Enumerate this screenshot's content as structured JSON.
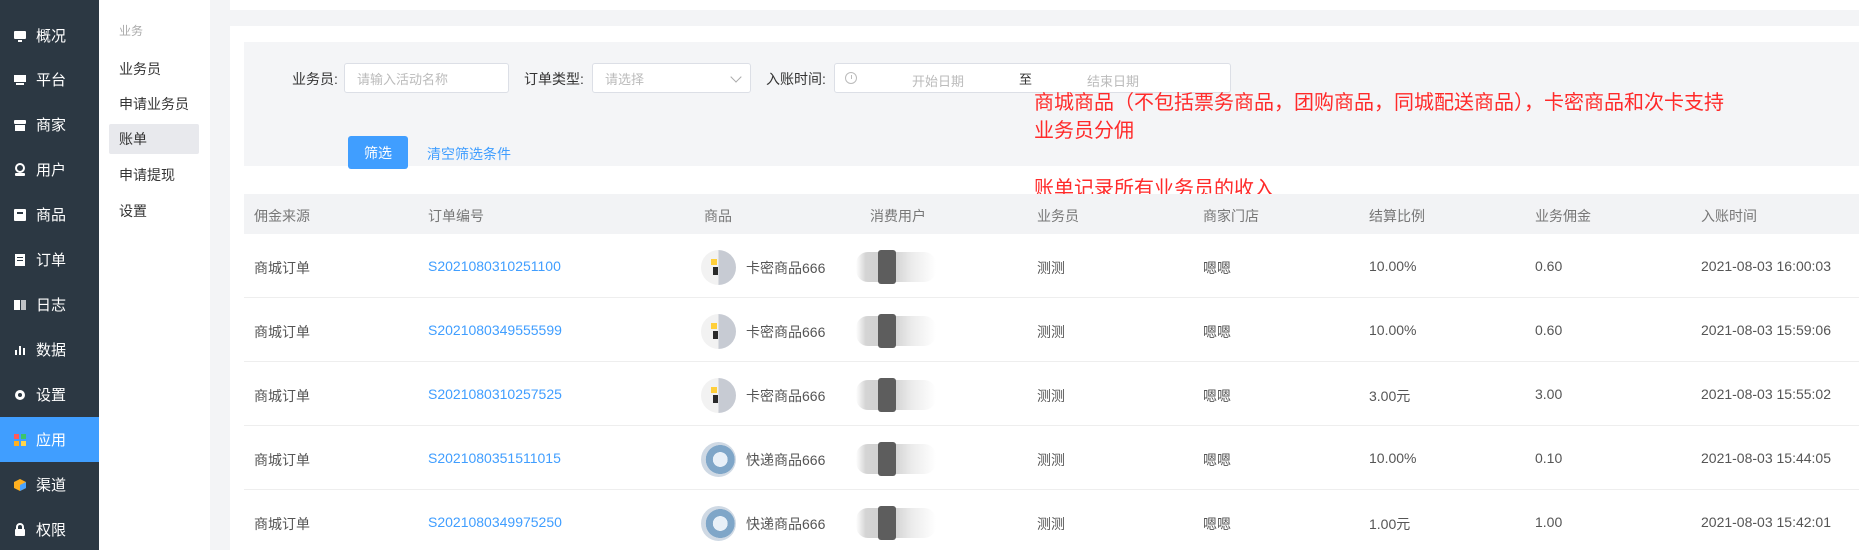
{
  "nav": {
    "items": [
      {
        "label": "概况",
        "icon": "monitor-icon"
      },
      {
        "label": "平台",
        "icon": "desktop-icon"
      },
      {
        "label": "商家",
        "icon": "store-icon"
      },
      {
        "label": "用户",
        "icon": "user-icon"
      },
      {
        "label": "商品",
        "icon": "goods-icon"
      },
      {
        "label": "订单",
        "icon": "order-icon"
      },
      {
        "label": "日志",
        "icon": "log-icon"
      },
      {
        "label": "数据",
        "icon": "chart-icon"
      },
      {
        "label": "设置",
        "icon": "gear-icon"
      },
      {
        "label": "应用",
        "icon": "apps-icon",
        "active": true
      },
      {
        "label": "渠道",
        "icon": "channel-icon"
      },
      {
        "label": "权限",
        "icon": "lock-icon"
      }
    ],
    "active_color": "#409eff"
  },
  "subnav": {
    "section": "业务",
    "items": [
      "业务员",
      "申请业务员",
      "账单",
      "申请提现",
      "设置"
    ],
    "active_index": 2
  },
  "filter": {
    "salesman_label": "业务员:",
    "salesman_placeholder": "请输入活动名称",
    "order_type_label": "订单类型:",
    "order_type_placeholder": "请选择",
    "time_label": "入账时间:",
    "start_placeholder": "开始日期",
    "range_sep": "至",
    "end_placeholder": "结束日期",
    "search_button": "筛选",
    "clear_link": "清空筛选条件"
  },
  "annotations": {
    "line1": "商城商品（不包括票务商品，团购商品，同城配送商品），卡密商品和次卡支持",
    "line2": "业务员分佣",
    "line3": "账单记录所有业务员的收入",
    "color": "#ff2a2a"
  },
  "table": {
    "headers": [
      "佣金来源",
      "订单编号",
      "商品",
      "消费用户",
      "业务员",
      "商家门店",
      "结算比例",
      "业务佣金",
      "入账时间"
    ],
    "rows": [
      {
        "source": "商城订单",
        "order_no": "S2021080310251100",
        "goods_type": "card",
        "goods": "卡密商品666",
        "salesman": "测测",
        "store": "嗯嗯",
        "ratio": "10.00%",
        "commission": "0.60",
        "time": "2021-08-03 16:00:03"
      },
      {
        "source": "商城订单",
        "order_no": "S2021080349555599",
        "goods_type": "card",
        "goods": "卡密商品666",
        "salesman": "测测",
        "store": "嗯嗯",
        "ratio": "10.00%",
        "commission": "0.60",
        "time": "2021-08-03 15:59:06"
      },
      {
        "source": "商城订单",
        "order_no": "S2021080310257525",
        "goods_type": "card",
        "goods": "卡密商品666",
        "salesman": "测测",
        "store": "嗯嗯",
        "ratio": "3.00元",
        "commission": "3.00",
        "time": "2021-08-03 15:55:02"
      },
      {
        "source": "商城订单",
        "order_no": "S2021080351511015",
        "goods_type": "express",
        "goods": "快递商品666",
        "salesman": "测测",
        "store": "嗯嗯",
        "ratio": "10.00%",
        "commission": "0.10",
        "time": "2021-08-03 15:44:05"
      },
      {
        "source": "商城订单",
        "order_no": "S2021080349975250",
        "goods_type": "express",
        "goods": "快递商品666",
        "salesman": "测测",
        "store": "嗯嗯",
        "ratio": "1.00元",
        "commission": "1.00",
        "time": "2021-08-03 15:42:01"
      }
    ]
  }
}
